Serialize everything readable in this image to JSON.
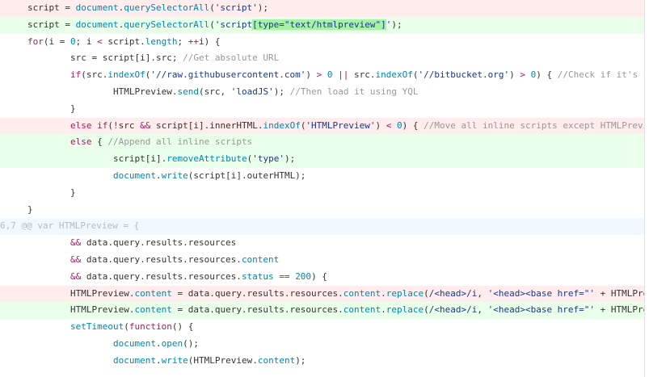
{
  "colors": {
    "deleted_bg": "#ffecec",
    "added_bg": "#eaffea",
    "hunk_bg": "#f1f8ff",
    "word_highlight": "#a6f3a6"
  },
  "lines": [
    {
      "type": "del",
      "indent": 1,
      "tokens": [
        [
          "script = ",
          ""
        ],
        [
          "document",
          "f"
        ],
        [
          ".",
          ""
        ],
        [
          "querySelectorAll",
          "f"
        ],
        [
          "(",
          ""
        ],
        [
          "'script'",
          "s"
        ],
        [
          ");",
          ""
        ]
      ]
    },
    {
      "type": "add",
      "indent": 1,
      "tokens": [
        [
          "script = ",
          ""
        ],
        [
          "document",
          "f"
        ],
        [
          ".",
          ""
        ],
        [
          "querySelectorAll",
          "f"
        ],
        [
          "(",
          ""
        ],
        [
          "'script",
          "s"
        ],
        [
          "[type=\"text/htmlpreview\"]",
          "s hl"
        ],
        [
          "'",
          "s"
        ],
        [
          ");",
          ""
        ]
      ]
    },
    {
      "type": "ctx",
      "indent": 1,
      "tokens": [
        [
          "for",
          "k"
        ],
        [
          "(i = ",
          ""
        ],
        [
          "0",
          "n"
        ],
        [
          "; i ",
          ""
        ],
        [
          "<",
          "o"
        ],
        [
          " script.",
          ""
        ],
        [
          "length",
          "f"
        ],
        [
          "; ",
          ""
        ],
        [
          "++",
          "o"
        ],
        [
          "i) {",
          ""
        ]
      ]
    },
    {
      "type": "ctx",
      "indent": 2,
      "tokens": [
        [
          "src = script[i].src; ",
          ""
        ],
        [
          "//Get absolute URL",
          "c"
        ]
      ]
    },
    {
      "type": "ctx",
      "indent": 2,
      "tokens": [
        [
          "if",
          "k"
        ],
        [
          "(src.",
          ""
        ],
        [
          "indexOf",
          "f"
        ],
        [
          "(",
          ""
        ],
        [
          "'//raw.githubusercontent.com'",
          "s"
        ],
        [
          ") ",
          ""
        ],
        [
          ">",
          "o"
        ],
        [
          " ",
          ""
        ],
        [
          "0",
          "n"
        ],
        [
          " ",
          ""
        ],
        [
          "||",
          "o"
        ],
        [
          " src.",
          ""
        ],
        [
          "indexOf",
          "f"
        ],
        [
          "(",
          ""
        ],
        [
          "'//bitbucket.org'",
          "s"
        ],
        [
          ") ",
          ""
        ],
        [
          ">",
          "o"
        ],
        [
          " ",
          ""
        ],
        [
          "0",
          "n"
        ],
        [
          ") { ",
          ""
        ],
        [
          "//Check if it's from raw.github.com or bitbucket.org",
          "c"
        ]
      ]
    },
    {
      "type": "ctx",
      "indent": 3,
      "tokens": [
        [
          "HTMLPreview.",
          ""
        ],
        [
          "send",
          "f"
        ],
        [
          "(src, ",
          ""
        ],
        [
          "'loadJS'",
          "s"
        ],
        [
          "); ",
          ""
        ],
        [
          "//Then load it using YQL",
          "c"
        ]
      ]
    },
    {
      "type": "ctx",
      "indent": 2,
      "tokens": [
        [
          "}",
          ""
        ]
      ]
    },
    {
      "type": "del",
      "indent": 2,
      "tokens": [
        [
          "else",
          "k"
        ],
        [
          " ",
          ""
        ],
        [
          "if",
          "k"
        ],
        [
          "(",
          ""
        ],
        [
          "!",
          "o"
        ],
        [
          "src ",
          ""
        ],
        [
          "&&",
          "o"
        ],
        [
          " script[i].innerHTML.",
          ""
        ],
        [
          "indexOf",
          "f"
        ],
        [
          "(",
          ""
        ],
        [
          "'HTMLPreview'",
          "s"
        ],
        [
          ") ",
          ""
        ],
        [
          "<",
          "o"
        ],
        [
          " ",
          ""
        ],
        [
          "0",
          "n"
        ],
        [
          ") { ",
          ""
        ],
        [
          "//Move all inline scripts except HTMLPreview.replaceAssets()",
          "c"
        ]
      ]
    },
    {
      "type": "add",
      "indent": 2,
      "tokens": [
        [
          "else",
          "k"
        ],
        [
          " { ",
          ""
        ],
        [
          "//Append all inline scripts",
          "c"
        ]
      ]
    },
    {
      "type": "add",
      "indent": 3,
      "tokens": [
        [
          "script[i].",
          ""
        ],
        [
          "removeAttribute",
          "f"
        ],
        [
          "(",
          ""
        ],
        [
          "'type'",
          "s"
        ],
        [
          ");",
          ""
        ]
      ]
    },
    {
      "type": "ctx",
      "indent": 3,
      "tokens": [
        [
          "document",
          "f"
        ],
        [
          ".",
          ""
        ],
        [
          "write",
          "f"
        ],
        [
          "(script[i].outerHTML);",
          ""
        ]
      ]
    },
    {
      "type": "ctx",
      "indent": 2,
      "tokens": [
        [
          "}",
          ""
        ]
      ]
    },
    {
      "type": "ctx",
      "indent": 1,
      "tokens": [
        [
          "}",
          ""
        ]
      ]
    },
    {
      "type": "hunk",
      "indent": 0,
      "tokens": [
        [
          "6,7 @@ var HTMLPreview = {",
          ""
        ]
      ]
    },
    {
      "type": "ctx",
      "indent": 2,
      "tokens": [
        [
          "&&",
          "o"
        ],
        [
          " data.query.results.resources",
          ""
        ]
      ]
    },
    {
      "type": "ctx",
      "indent": 2,
      "tokens": [
        [
          "&&",
          "o"
        ],
        [
          " data.query.results.resources.",
          ""
        ],
        [
          "content",
          "f"
        ]
      ]
    },
    {
      "type": "ctx",
      "indent": 2,
      "tokens": [
        [
          "&&",
          "o"
        ],
        [
          " data.query.results.resources.",
          ""
        ],
        [
          "status",
          "f"
        ],
        [
          " ",
          ""
        ],
        [
          "==",
          "o"
        ],
        [
          " ",
          ""
        ],
        [
          "200",
          "n"
        ],
        [
          ") {",
          ""
        ]
      ]
    },
    {
      "type": "del",
      "indent": 2,
      "tokens": [
        [
          "HTMLPreview.",
          ""
        ],
        [
          "content",
          "f"
        ],
        [
          " = data.query.results.resources.",
          ""
        ],
        [
          "content",
          "f"
        ],
        [
          ".",
          ""
        ],
        [
          "replace",
          "f"
        ],
        [
          "(",
          ""
        ],
        [
          "/<head>/i",
          "s"
        ],
        [
          ", ",
          ""
        ],
        [
          "'<head><base href=\"'",
          "s"
        ],
        [
          " + HTMLPreview.folder + ",
          ""
        ]
      ]
    },
    {
      "type": "add",
      "indent": 2,
      "tokens": [
        [
          "HTMLPreview.",
          ""
        ],
        [
          "content",
          "f"
        ],
        [
          " = data.query.results.resources.",
          ""
        ],
        [
          "content",
          "f"
        ],
        [
          ".",
          ""
        ],
        [
          "replace",
          "f"
        ],
        [
          "(",
          ""
        ],
        [
          "/<head>/i",
          "s"
        ],
        [
          ", ",
          ""
        ],
        [
          "'<head><base href=\"'",
          "s"
        ],
        [
          " + HTMLPreview.folder + ",
          ""
        ]
      ]
    },
    {
      "type": "ctx",
      "indent": 2,
      "tokens": [
        [
          "setTimeout",
          "f"
        ],
        [
          "(",
          ""
        ],
        [
          "function",
          "k"
        ],
        [
          "() {",
          ""
        ]
      ]
    },
    {
      "type": "ctx",
      "indent": 3,
      "tokens": [
        [
          "document",
          "f"
        ],
        [
          ".",
          ""
        ],
        [
          "open",
          "f"
        ],
        [
          "();",
          ""
        ]
      ]
    },
    {
      "type": "ctx",
      "indent": 3,
      "tokens": [
        [
          "document",
          "f"
        ],
        [
          ".",
          ""
        ],
        [
          "write",
          "f"
        ],
        [
          "(HTMLPreview.",
          ""
        ],
        [
          "content",
          "f"
        ],
        [
          ");",
          ""
        ]
      ]
    }
  ]
}
